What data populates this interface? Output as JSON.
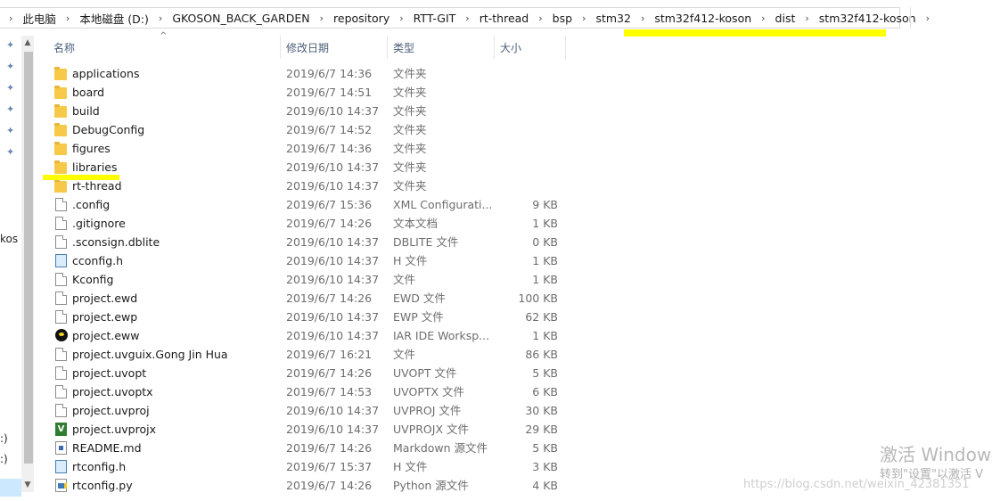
{
  "breadcrumb": [
    "此电脑",
    "本地磁盘 (D:)",
    "GKOSON_BACK_GARDEN",
    "repository",
    "RTT-GIT",
    "rt-thread",
    "bsp",
    "stm32",
    "stm32f412-koson",
    "dist",
    "stm32f412-koson"
  ],
  "nav_pane": {
    "fragment_1": "kos",
    "fragment_2": ":)",
    "fragment_3": ":)"
  },
  "columns": {
    "name": "名称",
    "date": "修改日期",
    "type": "类型",
    "size": "大小"
  },
  "files": [
    {
      "name": "applications",
      "date": "2019/6/7 14:36",
      "type": "文件夹",
      "size": "",
      "icon": "folder-icon"
    },
    {
      "name": "board",
      "date": "2019/6/7 14:51",
      "type": "文件夹",
      "size": "",
      "icon": "folder-icon"
    },
    {
      "name": "build",
      "date": "2019/6/10 14:37",
      "type": "文件夹",
      "size": "",
      "icon": "folder-icon"
    },
    {
      "name": "DebugConfig",
      "date": "2019/6/7 14:52",
      "type": "文件夹",
      "size": "",
      "icon": "folder-icon"
    },
    {
      "name": "figures",
      "date": "2019/6/7 14:36",
      "type": "文件夹",
      "size": "",
      "icon": "folder-icon"
    },
    {
      "name": "libraries",
      "date": "2019/6/10 14:37",
      "type": "文件夹",
      "size": "",
      "icon": "folder-icon"
    },
    {
      "name": "rt-thread",
      "date": "2019/6/10 14:37",
      "type": "文件夹",
      "size": "",
      "icon": "folder-icon"
    },
    {
      "name": ".config",
      "date": "2019/6/7 15:36",
      "type": "XML Configurati...",
      "size": "9 KB",
      "icon": "file-icon"
    },
    {
      "name": ".gitignore",
      "date": "2019/6/7 14:26",
      "type": "文本文档",
      "size": "1 KB",
      "icon": "text-file-icon"
    },
    {
      "name": ".sconsign.dblite",
      "date": "2019/6/10 14:37",
      "type": "DBLITE 文件",
      "size": "0 KB",
      "icon": "file-icon"
    },
    {
      "name": "cconfig.h",
      "date": "2019/6/10 14:37",
      "type": "H 文件",
      "size": "1 KB",
      "icon": "h-file-icon"
    },
    {
      "name": "Kconfig",
      "date": "2019/6/10 14:37",
      "type": "文件",
      "size": "1 KB",
      "icon": "file-icon"
    },
    {
      "name": "project.ewd",
      "date": "2019/6/7 14:26",
      "type": "EWD 文件",
      "size": "100 KB",
      "icon": "file-icon"
    },
    {
      "name": "project.ewp",
      "date": "2019/6/10 14:37",
      "type": "EWP 文件",
      "size": "62 KB",
      "icon": "file-icon"
    },
    {
      "name": "project.eww",
      "date": "2019/6/10 14:37",
      "type": "IAR IDE Worksp...",
      "size": "1 KB",
      "icon": "iar-workspace-icon"
    },
    {
      "name": "project.uvguix.Gong Jin Hua",
      "date": "2019/6/7 16:21",
      "type": "文件",
      "size": "86 KB",
      "icon": "file-icon"
    },
    {
      "name": "project.uvopt",
      "date": "2019/6/7 14:26",
      "type": "UVOPT 文件",
      "size": "5 KB",
      "icon": "file-icon"
    },
    {
      "name": "project.uvoptx",
      "date": "2019/6/7 14:53",
      "type": "UVOPTX 文件",
      "size": "6 KB",
      "icon": "file-icon"
    },
    {
      "name": "project.uvproj",
      "date": "2019/6/10 14:37",
      "type": "UVPROJ 文件",
      "size": "30 KB",
      "icon": "file-icon"
    },
    {
      "name": "project.uvprojx",
      "date": "2019/6/10 14:37",
      "type": "UVPROJX 文件",
      "size": "29 KB",
      "icon": "keil-project-icon"
    },
    {
      "name": "README.md",
      "date": "2019/6/7 14:26",
      "type": "Markdown 源文件",
      "size": "5 KB",
      "icon": "markdown-file-icon"
    },
    {
      "name": "rtconfig.h",
      "date": "2019/6/7 15:37",
      "type": "H 文件",
      "size": "3 KB",
      "icon": "h-file-icon"
    },
    {
      "name": "rtconfig.py",
      "date": "2019/6/7 14:26",
      "type": "Python 源文件",
      "size": "4 KB",
      "icon": "python-file-icon"
    }
  ],
  "watermark": {
    "activate_title": "激活 Window",
    "activate_hint": "转到\"设置\"以激活 V",
    "blog_url": "https://blog.csdn.net/weixin_42381351"
  },
  "colors": {
    "highlight": "#ffff00",
    "folder": "#f7c948",
    "selection": "#cce8ff"
  }
}
